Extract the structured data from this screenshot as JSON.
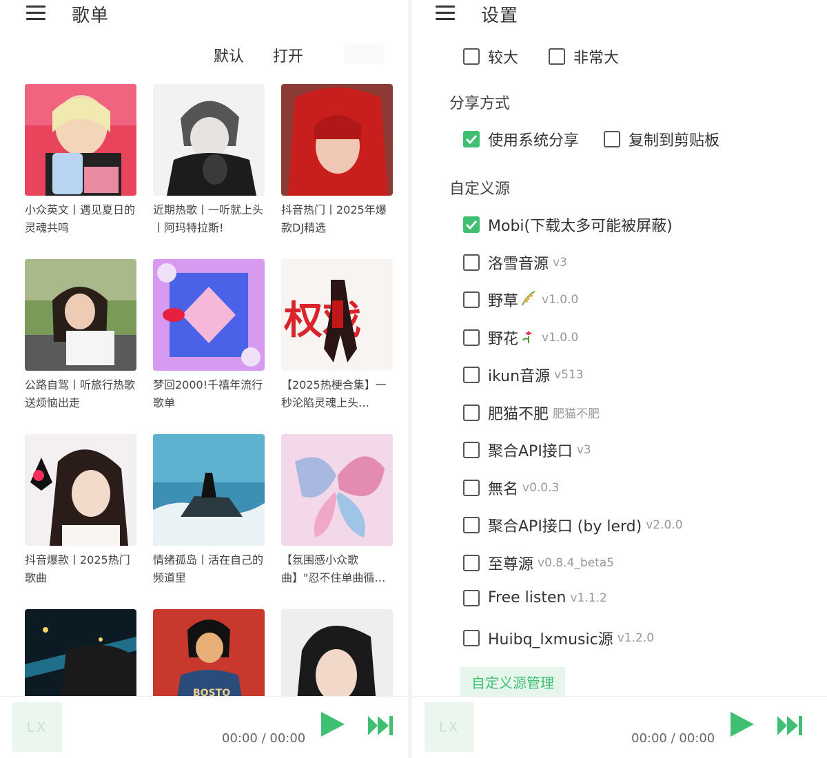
{
  "left_panel": {
    "title": "歌单",
    "sort_options": [
      "默认",
      "打开"
    ],
    "playlists": [
      {
        "title": "小众英文丨遇见夏日的灵魂共鸣"
      },
      {
        "title": "近期热歌丨一听就上头丨阿玛特拉斯!"
      },
      {
        "title": "抖音热门丨2025年爆款DJ精选"
      },
      {
        "title": "公路自驾丨听旅行热歌送烦恼出走"
      },
      {
        "title": "梦回2000!千禧年流行歌单"
      },
      {
        "title": "【2025热梗合集】一秒沦陷灵魂上头…"
      },
      {
        "title": "抖音爆款丨2025热门歌曲"
      },
      {
        "title": "情绪孤岛丨活在自己的频道里"
      },
      {
        "title": "【氛围感小众歌曲】\"忍不住单曲循…"
      },
      {
        "title": ""
      },
      {
        "title": ""
      },
      {
        "title": ""
      }
    ],
    "cover_art_text": {
      "quanxi": "权戏",
      "shirt": "BOSTO"
    },
    "player": {
      "logo": "LX",
      "time": "00:00 / 00:00"
    }
  },
  "right_panel": {
    "title": "设置",
    "font_size_options": [
      {
        "label": "较大",
        "checked": false
      },
      {
        "label": "非常大",
        "checked": false
      }
    ],
    "share_section": {
      "title": "分享方式",
      "options": [
        {
          "label": "使用系统分享",
          "checked": true
        },
        {
          "label": "复制到剪贴板",
          "checked": false
        }
      ]
    },
    "custom_source_section": {
      "title": "自定义源",
      "sources": [
        {
          "label": "Mobi(下载太多可能被屏蔽)",
          "version": "",
          "checked": true,
          "emoji": ""
        },
        {
          "label": "洛雪音源",
          "version": "v3",
          "checked": false,
          "emoji": ""
        },
        {
          "label": "野草",
          "version": "v1.0.0",
          "checked": false,
          "emoji": "rice-plant"
        },
        {
          "label": "野花",
          "version": "v1.0.0",
          "checked": false,
          "emoji": "tulip"
        },
        {
          "label": "ikun音源",
          "version": "v513",
          "checked": false,
          "emoji": ""
        },
        {
          "label": "肥猫不肥",
          "version": "肥猫不肥",
          "checked": false,
          "emoji": ""
        },
        {
          "label": "聚合API接口",
          "version": "v3",
          "checked": false,
          "emoji": ""
        },
        {
          "label": "無名",
          "version": "v0.0.3",
          "checked": false,
          "emoji": ""
        },
        {
          "label": "聚合API接口 (by lerd)",
          "version": "v2.0.0",
          "checked": false,
          "emoji": ""
        },
        {
          "label": "至尊源",
          "version": "v0.8.4_beta5",
          "checked": false,
          "emoji": ""
        },
        {
          "label": "Free listen",
          "version": "v1.1.2",
          "checked": false,
          "emoji": ""
        },
        {
          "label": "Huibq_lxmusic源",
          "version": "v1.2.0",
          "checked": false,
          "emoji": ""
        }
      ],
      "manage_label": "自定义源管理"
    },
    "player": {
      "logo": "LX",
      "time": "00:00 / 00:00"
    }
  },
  "colors": {
    "accent": "#3fbf72",
    "text": "#333333",
    "muted": "#999999"
  },
  "icons": [
    "menu-icon",
    "play-icon",
    "next-icon",
    "checkmark-icon"
  ]
}
